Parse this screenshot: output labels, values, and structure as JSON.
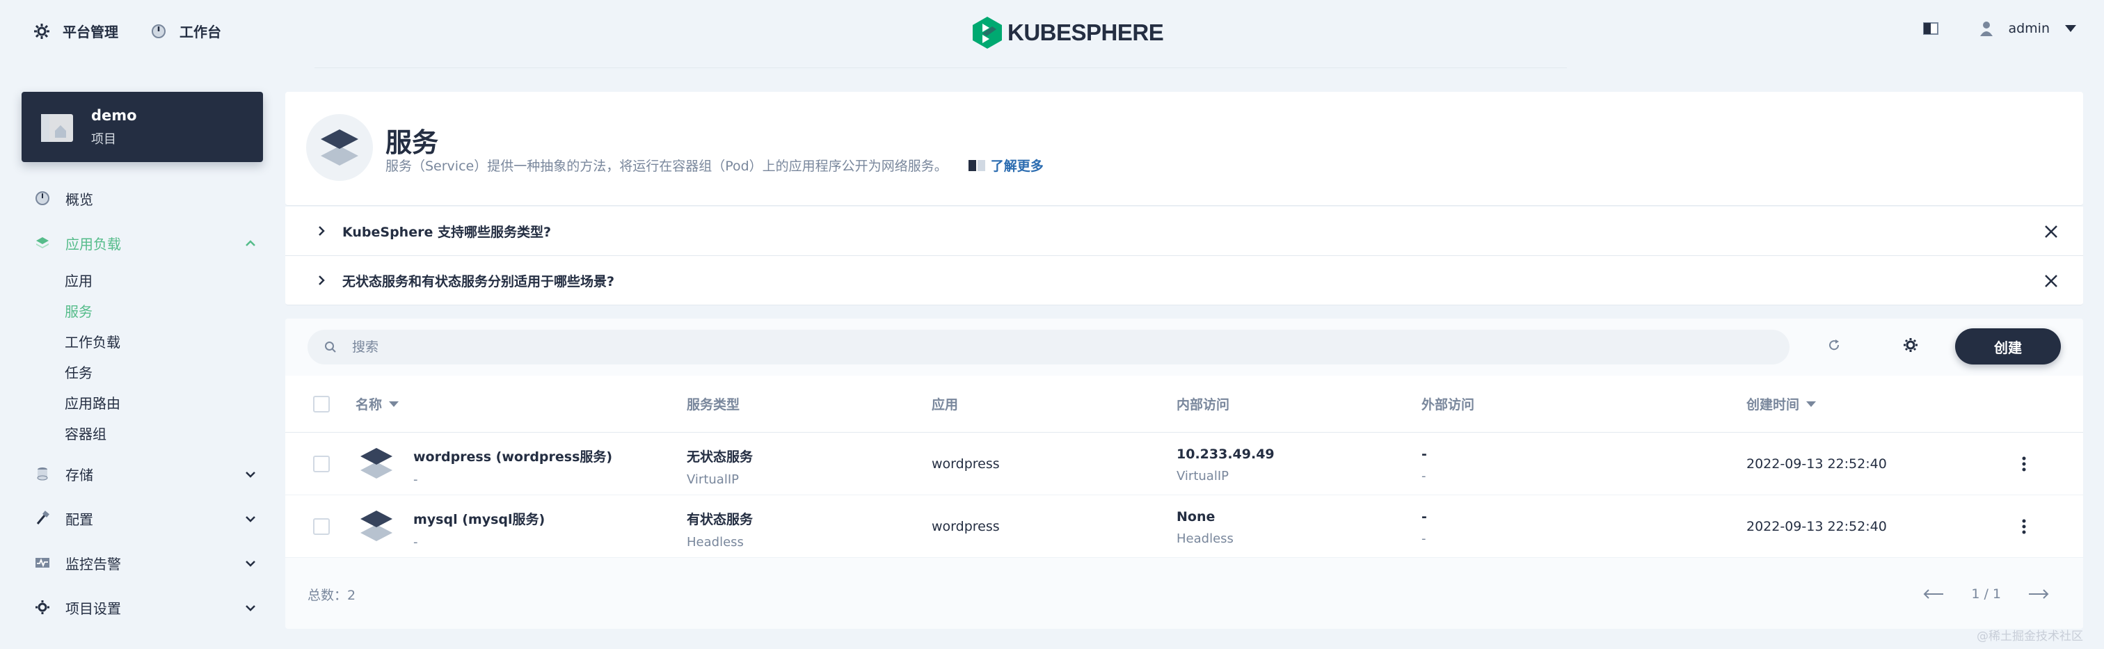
{
  "topbar": {
    "nav": [
      {
        "label": "平台管理",
        "icon": "gear-icon"
      },
      {
        "label": "工作台",
        "icon": "dashboard-icon"
      }
    ],
    "logo_text": "KUBESPHERE",
    "user": "admin"
  },
  "project": {
    "name": "demo",
    "type": "项目"
  },
  "sidebar": {
    "items": [
      {
        "label": "概览",
        "icon": "overview-icon"
      },
      {
        "label": "应用负载",
        "icon": "app-workloads-icon",
        "active": true
      },
      {
        "label": "存储",
        "icon": "storage-icon"
      },
      {
        "label": "配置",
        "icon": "config-icon"
      },
      {
        "label": "监控告警",
        "icon": "monitoring-icon"
      },
      {
        "label": "项目设置",
        "icon": "settings-icon"
      }
    ],
    "subitems": [
      "应用",
      "服务",
      "工作负载",
      "任务",
      "应用路由",
      "容器组"
    ],
    "active_subitem": "服务"
  },
  "header": {
    "title": "服务",
    "description": "服务（Service）提供一种抽象的方法，将运行在容器组（Pod）上的应用程序公开为网络服务。",
    "learn_more": "了解更多"
  },
  "faq": [
    "KubeSphere 支持哪些服务类型?",
    "无状态服务和有状态服务分别适用于哪些场景?"
  ],
  "toolbar": {
    "search_placeholder": "搜索",
    "create_label": "创建"
  },
  "table": {
    "columns": [
      "名称",
      "服务类型",
      "应用",
      "内部访问",
      "外部访问",
      "创建时间"
    ],
    "rows": [
      {
        "name": "wordpress (wordpress服务)",
        "name_sub": "-",
        "type": "无状态服务",
        "type_sub": "VirtualIP",
        "app": "wordpress",
        "internal": "10.233.49.49",
        "internal_sub": "VirtualIP",
        "external": "-",
        "external_sub": "-",
        "created": "2022-09-13 22:52:40"
      },
      {
        "name": "mysql (mysql服务)",
        "name_sub": "-",
        "type": "有状态服务",
        "type_sub": "Headless",
        "app": "wordpress",
        "internal": "None",
        "internal_sub": "Headless",
        "external": "-",
        "external_sub": "-",
        "created": "2022-09-13 22:52:40"
      }
    ]
  },
  "footer": {
    "total": "总数：2",
    "page": "1 / 1"
  },
  "watermark": "@稀土掘金技术社区",
  "colors": {
    "accent": "#55bc8a",
    "dark": "#242e42",
    "muted": "#79879c",
    "link": "#3385ff"
  }
}
